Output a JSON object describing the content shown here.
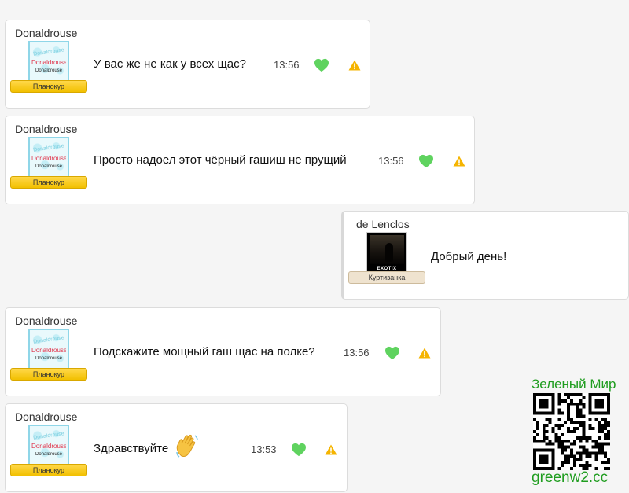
{
  "messages": [
    {
      "author": "Donaldrouse",
      "rank": "Планокур",
      "text": "У вас же не как у всех щас?",
      "time": "13:56",
      "avatar_text": [
        "Donaldrouse",
        "Donaldrouse",
        "Donaldrouse"
      ]
    },
    {
      "author": "Donaldrouse",
      "rank": "Планокур",
      "text": "Просто надоел этот чёрный гашиш не прущий",
      "time": "13:56",
      "avatar_text": [
        "Donaldrouse",
        "Donaldrouse",
        "Donaldrouse"
      ]
    },
    {
      "author": "de Lenclos",
      "rank": "Куртизанка",
      "text": "Добрый день!",
      "avatar_text": [
        "EXOTIX"
      ]
    },
    {
      "author": "Donaldrouse",
      "rank": "Планокур",
      "text": "Подскажите мощный гаш щас на полке?",
      "time": "13:56",
      "avatar_text": [
        "Donaldrouse",
        "Donaldrouse",
        "Donaldrouse"
      ]
    },
    {
      "author": "Donaldrouse",
      "rank": "Планокур",
      "text": "Здравствуйте",
      "time": "13:53",
      "avatar_text": [
        "Donaldrouse",
        "Donaldrouse",
        "Donaldrouse"
      ]
    }
  ],
  "icons": {
    "like": "heart-icon",
    "report": "warning-icon",
    "emoji": "waving-hand-emoji"
  },
  "colors": {
    "rank_gold": "#f2c000",
    "rank_beige": "#efe3cf",
    "heart": "#5fd35f",
    "warning": "#f5b400",
    "promo": "#1f9d1f"
  },
  "promo": {
    "title": "Зеленый Мир",
    "url": "greenw2.cc"
  }
}
